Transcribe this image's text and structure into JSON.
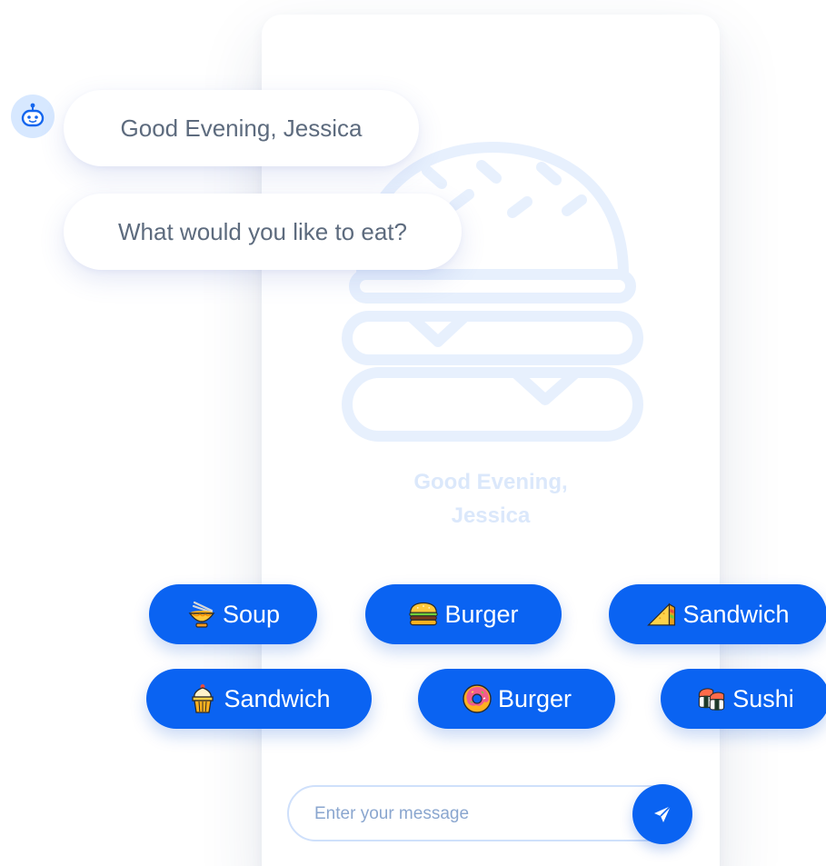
{
  "watermark": {
    "line1": "Good Evening,",
    "line2": "Jessica"
  },
  "assistant": {
    "icon": "robot-icon",
    "messages": [
      {
        "text": "Good Evening, Jessica"
      },
      {
        "text": "What would you like to eat?"
      }
    ]
  },
  "options": [
    {
      "label": "Soup",
      "icon": "noodle-bowl-icon"
    },
    {
      "label": "Burger",
      "icon": "burger-icon"
    },
    {
      "label": "Sandwich",
      "icon": "sandwich-icon"
    },
    {
      "label": "Sandwich",
      "icon": "cupcake-icon"
    },
    {
      "label": "Burger",
      "icon": "donut-icon"
    },
    {
      "label": "Sushi",
      "icon": "sushi-icon"
    }
  ],
  "composer": {
    "placeholder": "Enter your message",
    "send_icon": "send-icon"
  },
  "colors": {
    "accent": "#0a63f2",
    "bubble_text": "#5d6b7e",
    "watermark": "#dbe8fb",
    "avatar_bg": "#d7e8ff"
  }
}
